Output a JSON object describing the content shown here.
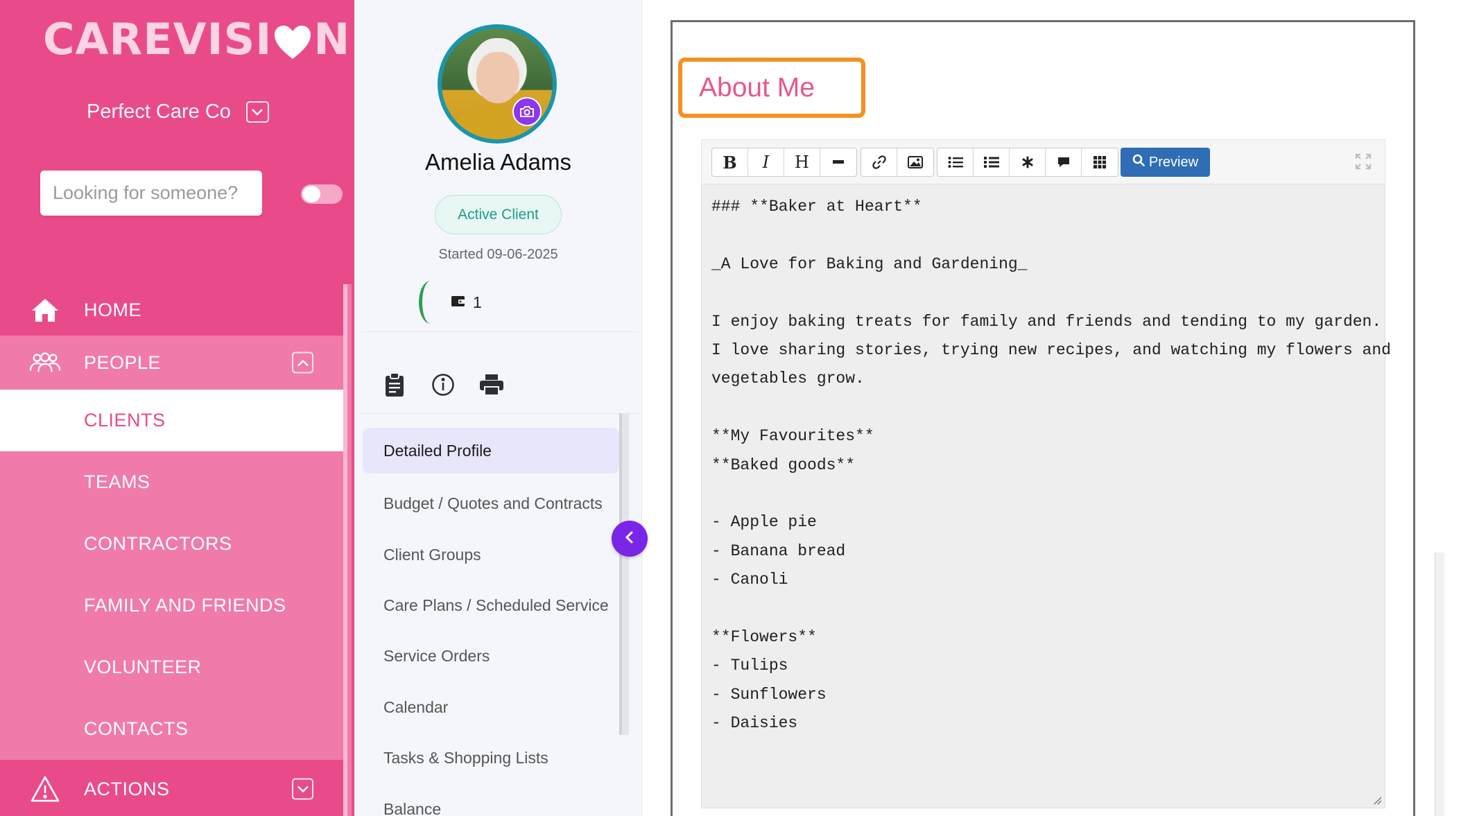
{
  "brand": {
    "logo_text_left": "CAREVISI",
    "logo_text_right": "N",
    "accent": "#e94b8a",
    "accent_light": "#f07aa9"
  },
  "sidebar": {
    "organization": "Perfect Care Co",
    "search_placeholder": "Looking for someone?",
    "nav": {
      "home": "HOME",
      "people": "PEOPLE",
      "people_children": [
        "CLIENTS",
        "TEAMS",
        "CONTRACTORS",
        "FAMILY AND FRIENDS",
        "VOLUNTEER",
        "CONTACTS"
      ],
      "active_child": "CLIENTS",
      "actions": "ACTIONS"
    }
  },
  "client": {
    "name": "Amelia Adams",
    "status": "Active Client",
    "started": "Started 09-06-2025",
    "wallet_count": "1",
    "tool_icons": [
      "clipboard-icon",
      "info-icon",
      "print-icon"
    ],
    "menu": [
      "Detailed Profile",
      "Budget / Quotes and Contracts",
      "Client Groups",
      "Care Plans / Scheduled Service",
      "Service Orders",
      "Calendar",
      "Tasks & Shopping Lists",
      "Balance"
    ],
    "active_menu": "Detailed Profile"
  },
  "editor": {
    "section_title": "About Me",
    "toolbar_icons": [
      "bold-icon",
      "italic-icon",
      "heading-icon",
      "horizontal-rule-icon",
      "link-icon",
      "image-icon",
      "unordered-list-icon",
      "ordered-list-icon",
      "asterisk-icon",
      "comment-icon",
      "table-icon"
    ],
    "bold_glyph": "B",
    "italic_glyph": "I",
    "heading_glyph": "H",
    "preview_label": "Preview",
    "lines": [
      "### **Baker at Heart**",
      "",
      "_A Love for Baking and Gardening_",
      "",
      "I enjoy baking treats for family and friends and tending to my garden.",
      "I love sharing stories, trying new recipes, and watching my flowers and",
      "vegetables grow.",
      "",
      "**My Favourites**",
      "**Baked goods**",
      "",
      "- Apple pie",
      "- Banana bread",
      "- Canoli",
      "",
      "**Flowers**",
      "- Tulips",
      "- Sunflowers",
      "- Daisies"
    ]
  }
}
